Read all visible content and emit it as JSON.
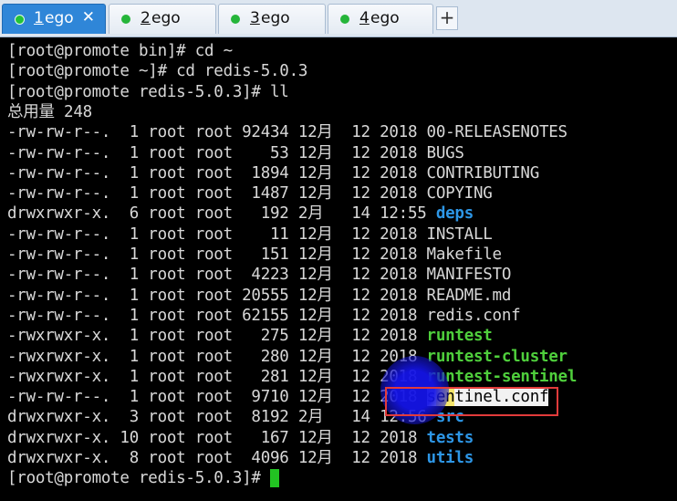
{
  "tabs": [
    {
      "num": "1",
      "label": " ego",
      "active": true,
      "close": "✕"
    },
    {
      "num": "2",
      "label": " ego",
      "active": false
    },
    {
      "num": "3",
      "label": " ego",
      "active": false
    },
    {
      "num": "4",
      "label": " ego",
      "active": false
    }
  ],
  "new_tab": "+",
  "terminal_lines": [
    {
      "parts": [
        {
          "t": "[root@promote bin]# cd ~",
          "c": "n"
        }
      ]
    },
    {
      "parts": [
        {
          "t": "[root@promote ~]# cd redis-5.0.3",
          "c": "n"
        }
      ]
    },
    {
      "parts": [
        {
          "t": "[root@promote redis-5.0.3]# ll",
          "c": "n"
        }
      ]
    },
    {
      "parts": [
        {
          "t": "总用量 248",
          "c": "n"
        }
      ]
    },
    {
      "parts": [
        {
          "t": "-rw-rw-r--.  1 root root 92434 12月  12 2018 00-RELEASENOTES",
          "c": "n"
        }
      ]
    },
    {
      "parts": [
        {
          "t": "-rw-rw-r--.  1 root root    53 12月  12 2018 BUGS",
          "c": "n"
        }
      ]
    },
    {
      "parts": [
        {
          "t": "-rw-rw-r--.  1 root root  1894 12月  12 2018 CONTRIBUTING",
          "c": "n"
        }
      ]
    },
    {
      "parts": [
        {
          "t": "-rw-rw-r--.  1 root root  1487 12月  12 2018 COPYING",
          "c": "n"
        }
      ]
    },
    {
      "parts": [
        {
          "t": "drwxrwxr-x.  6 root root   192 2月   14 12:55 ",
          "c": "n"
        },
        {
          "t": "deps",
          "c": "dir"
        }
      ]
    },
    {
      "parts": [
        {
          "t": "-rw-rw-r--.  1 root root    11 12月  12 2018 INSTALL",
          "c": "n"
        }
      ]
    },
    {
      "parts": [
        {
          "t": "-rw-rw-r--.  1 root root   151 12月  12 2018 Makefile",
          "c": "n"
        }
      ]
    },
    {
      "parts": [
        {
          "t": "-rw-rw-r--.  1 root root  4223 12月  12 2018 MANIFESTO",
          "c": "n"
        }
      ]
    },
    {
      "parts": [
        {
          "t": "-rw-rw-r--.  1 root root 20555 12月  12 2018 README.md",
          "c": "n"
        }
      ]
    },
    {
      "parts": [
        {
          "t": "-rw-rw-r--.  1 root root 62155 12月  12 2018 redis.conf",
          "c": "n"
        }
      ]
    },
    {
      "parts": [
        {
          "t": "-rwxrwxr-x.  1 root root   275 12月  12 2018 ",
          "c": "n"
        },
        {
          "t": "runtest",
          "c": "exe"
        }
      ]
    },
    {
      "parts": [
        {
          "t": "-rwxrwxr-x.  1 root root   280 12月  12 2018 ",
          "c": "n"
        },
        {
          "t": "runtest-cluster",
          "c": "exe"
        }
      ]
    },
    {
      "parts": [
        {
          "t": "-rwxrwxr-x.  1 root root   281 12月  12 2018 ",
          "c": "n"
        },
        {
          "t": "runtest-sentinel",
          "c": "exe"
        }
      ]
    },
    {
      "parts": [
        {
          "t": "-rw-rw-r--.  1 root root  9710 12月  12 2018 ",
          "c": "n"
        },
        {
          "t": "s",
          "c": "hl"
        },
        {
          "t": "en",
          "c": "hl-y"
        },
        {
          "t": "tinel.conf",
          "c": "hl"
        }
      ]
    },
    {
      "parts": [
        {
          "t": "drwxrwxr-x.  3 root root  8192 2月   14 12:56 ",
          "c": "n"
        },
        {
          "t": "src",
          "c": "dir"
        }
      ]
    },
    {
      "parts": [
        {
          "t": "drwxrwxr-x. 10 root root   167 12月  12 2018 ",
          "c": "n"
        },
        {
          "t": "tests",
          "c": "dir"
        }
      ]
    },
    {
      "parts": [
        {
          "t": "drwxrwxr-x.  8 root root  4096 12月  12 2018 ",
          "c": "n"
        },
        {
          "t": "utils",
          "c": "dir"
        }
      ]
    },
    {
      "parts": [
        {
          "t": "[root@promote redis-5.0.3]# ",
          "c": "n"
        }
      ]
    }
  ],
  "colors": {
    "terminal_bg": "#000000",
    "text": "#d8d8d8",
    "directory": "#2d96e6",
    "executable": "#4fcf3c",
    "cursor": "#22c322",
    "annotation_box": "#e23b3b",
    "tab_active": "#2f86d8"
  }
}
